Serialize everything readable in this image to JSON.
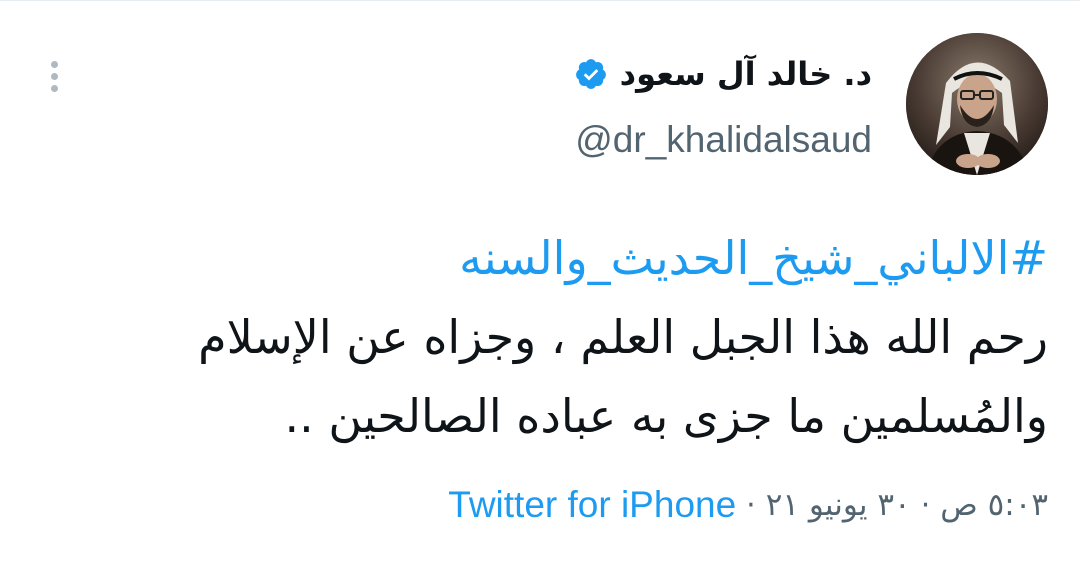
{
  "tweet": {
    "author": {
      "display_name": "د. خالد آل سعود",
      "handle": "@dr_khalidalsaud",
      "verified": true,
      "verified_icon": "verified-badge-icon"
    },
    "hashtag": "#الالباني_شيخ_الحديث_والسنه",
    "text_lines": [
      "رحم الله هذا الجبل العلم ، وجزاه عن الإسلام",
      "والمُسلمين ما جزى به عباده الصالحين .."
    ],
    "timestamp": "٥:٠٣ ص",
    "date": "٣٠ يونيو ٢١",
    "source": "Twitter for iPhone",
    "separator": "·",
    "more_icon": "more-options-icon"
  },
  "colors": {
    "accent": "#1d9bf0",
    "text": "#0f1419",
    "secondary": "#536471"
  }
}
